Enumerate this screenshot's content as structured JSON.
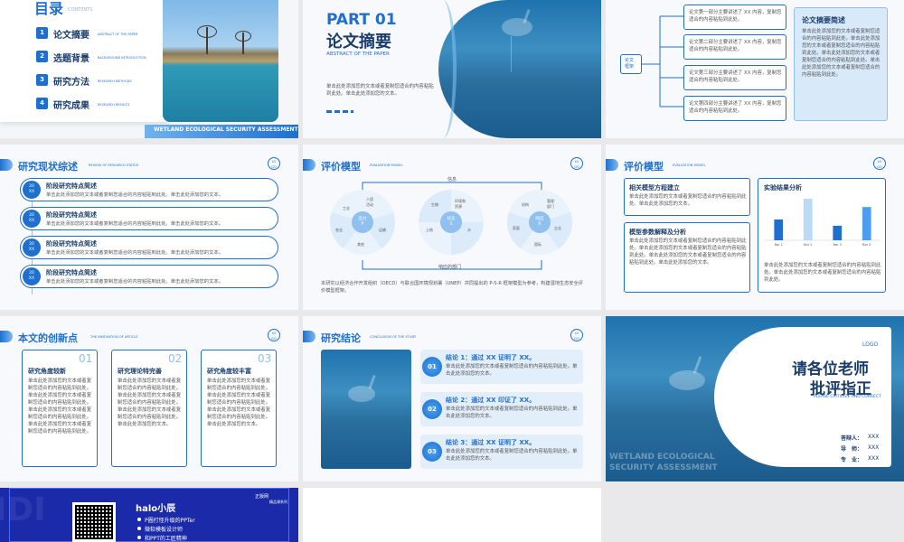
{
  "s1": {
    "title": "目录",
    "title_en": "CONTENTS",
    "items": [
      {
        "n": "1",
        "zh": "论文摘要",
        "en": "ABSTRACT OF THE PAPER"
      },
      {
        "n": "2",
        "zh": "选题背景",
        "en": "BACKGROUND INTRODUCTION"
      },
      {
        "n": "3",
        "zh": "研究方法",
        "en": "RESEARCH METHODS"
      },
      {
        "n": "4",
        "zh": "研究成果",
        "en": "RESEARCH RESULTS"
      }
    ],
    "footer": "WETLAND ECOLOGICAL SECURITY ASSESSMENT"
  },
  "s2": {
    "part": "PART 01",
    "title": "论文摘要",
    "subtitle": "ABSTRACT OF THE PAPER",
    "body": "单击此处添加您的文本或者复制您适合的内容粘贴到此处。单击此处添加您的文本。"
  },
  "s3": {
    "label": "论文\n框架",
    "items": [
      "论文第一部分主要讲述了 XX 内容，复制您适合的内容粘贴到此处。",
      "论文第二部分主要讲述了 XX 内容，复制您适合的内容粘贴到此处。",
      "论文第三部分主要讲述了 XX 内容，复制您适合的内容粘贴到此处。",
      "论文第四部分主要讲述了 XX 内容，复制您适合的内容粘贴到此处。"
    ],
    "card_title": "论文摘要简述",
    "card_body": "单击此处添加您的文本或者复制您适合的内容粘贴到此处。单击此处添加您的文本或者复制您适合的内容粘贴到此处。单击此处添加您的文本或者复制您适合的内容粘贴到此处。单击此处添加您的文本或者复制您适合的内容粘贴到此处。"
  },
  "s4": {
    "title": "研究现状综述",
    "sub": "REVIEW OF RESEARCH STATUS",
    "logo": "LO\nGO",
    "badge": "20\nXX",
    "rows": [
      {
        "title": "阶段研究特点简述",
        "body": "单击此处添加您的文本或者复制您适合的内容粘贴到此处。单击此处添加您的文本。"
      },
      {
        "title": "阶段研究特点简述",
        "body": "单击此处添加您的文本或者复制您适合的内容粘贴到此处。单击此处添加您的文本。"
      },
      {
        "title": "阶段研究特点简述",
        "body": "单击此处添加您的文本或者复制您适合的内容粘贴到此处。单击此处添加您的文本。"
      },
      {
        "title": "阶段研究特点简述",
        "body": "单击此处添加您的文本或者复制您适合的内容粘贴到此处。单击此处添加您的文本。"
      }
    ]
  },
  "s5": {
    "title": "评价模型",
    "sub": "EVALUATION MODEL",
    "logo": "LO\nGO",
    "top_label": "信息",
    "bottom_label": "响应的部门",
    "wheels": [
      {
        "center": "压力\nP",
        "labels": [
          "工业",
          "人居\n活动",
          "运输",
          "其他",
          "农业"
        ]
      },
      {
        "center": "状态\nS",
        "labels": [
          "生物",
          "环境和\n资源",
          "水",
          "土地"
        ]
      },
      {
        "center": "响应\nR",
        "labels": [
          "机构",
          "管理\n部门",
          "企业",
          "国际",
          "家庭"
        ]
      }
    ],
    "note": "本研究以经济合作开发组织（OECD）与联合国环境规划署（UNEP）共同提出的 P-S-R 框架模型为参考，构建湿地生态安全评价模型框架。"
  },
  "s6": {
    "title": "评价模型",
    "sub": "EVALUATION MODEL",
    "logo": "LO\nGO",
    "box1_title": "相关模型方程建立",
    "box1_body": "单击此处添加您的文本或者复制您适合的内容粘贴到此处。单击此处添加您的文本。",
    "box2_title": "模型参数解释及分析",
    "box2_body": "单击此处添加您的文本或者复制您适合的内容粘贴到此处。单击此处添加您的文本或者复制您适合的内容粘贴到此处。单击此处添加您的文本或者复制您适合的内容粘贴到此处。单击此处添加您的文本。",
    "box3_title": "实验结果分析",
    "box3_body": "单击此处添加您的文本或者复制您适合的内容粘贴到此处。单击此处添加您的文本或者复制您适合的内容粘贴到此处。",
    "chart_data": {
      "type": "bar",
      "categories": [
        "Bar 1",
        "Bar 2",
        "Bar 3",
        "Bar 4"
      ],
      "values": [
        5,
        10,
        3.5,
        8
      ],
      "ylim": [
        0,
        10
      ]
    }
  },
  "s7": {
    "title": "本文的创新点",
    "sub": "THE INNOVATION OF ARTICLE",
    "logo": "LO\nGO",
    "cards": [
      {
        "n": "01",
        "title": "研究角度较新",
        "body": "单击此处添加您的文本或者复制您适合的内容粘贴到此处。单击此处添加您的文本或者复制您适合的内容粘贴到此处。单击此处添加您的文本或者复制您适合的内容粘贴到此处。单击此处添加您的文本或者复制您适合的内容粘贴到此处。"
      },
      {
        "n": "02",
        "title": "研究理论特完善",
        "body": "单击此处添加您的文本或者复制您适合的内容粘贴到此处。单击此处添加您的文本或者复制您适合的内容粘贴到此处。单击此处添加您的文本或者复制您适合的内容粘贴到此处。单击此处添加您的文本。"
      },
      {
        "n": "03",
        "title": "研究角度较丰富",
        "body": "单击此处添加您的文本或者复制您适合的内容粘贴到此处。单击此处添加您的文本或者复制您适合的内容粘贴到此处。单击此处添加您的文本或者复制您适合的内容粘贴到此处。单击此处添加您的文本。"
      }
    ]
  },
  "s8": {
    "title": "研究结论",
    "sub": "CONCLUSION OF THE STUDY",
    "logo": "LO\nGO",
    "items": [
      {
        "n": "01",
        "title": "结论 1：通过 XX 证明了 XX。",
        "body": "单击此处添加您的文本或者复制您适合的内容粘贴到此处。单击此处添加您的文本。"
      },
      {
        "n": "02",
        "title": "结论 2：通过 XX 印证了 XX。",
        "body": "单击此处添加您的文本或者复制您适合的内容粘贴到此处。单击此处添加您的文本。"
      },
      {
        "n": "03",
        "title": "结论 3：通过 XX 证明了 XX。",
        "body": "单击此处添加您的文本或者复制您适合的内容粘贴到此处。单击此处添加您的文本。"
      }
    ]
  },
  "s9": {
    "logo": "LOGO",
    "title1": "请各位老师",
    "title2": "批评指正",
    "sub": "PLEASE CRITICIZE AND CORRECT",
    "footer": "WETLAND ECOLOGICAL SECURITY ASSESSMENT",
    "fields": [
      {
        "k": "答辩人：",
        "v": "XXX"
      },
      {
        "k": "导　师：",
        "v": "XXX"
      },
      {
        "k": "专　业：",
        "v": "XXX"
      }
    ]
  },
  "s10": {
    "name": "halo小辰",
    "bullets": [
      "P圈打怪升级的PPTer",
      "微软模板设计师",
      "和PPT的工匠精神"
    ],
    "brand": "正版网",
    "brand_sub": "精品课系列"
  }
}
